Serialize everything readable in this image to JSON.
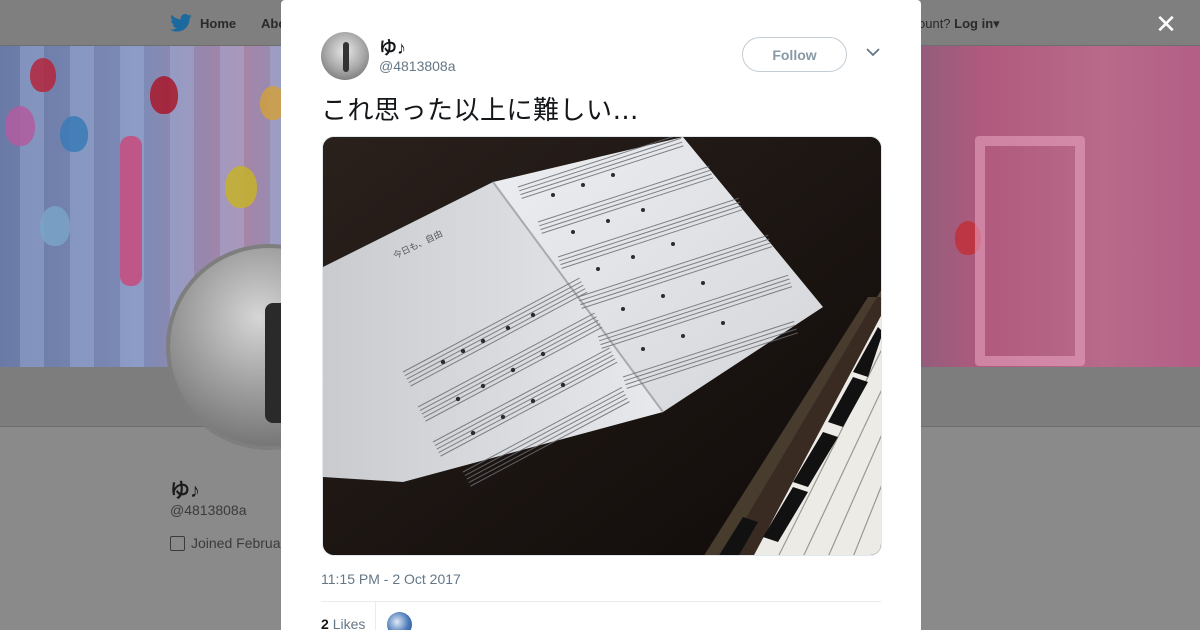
{
  "nav": {
    "home_label": "Home",
    "about_label": "Abo",
    "account_prompt": "ccount?",
    "login_label": "Log in"
  },
  "profile": {
    "name": "ゆ♪",
    "handle": "@4813808a",
    "joined": "Joined Februa"
  },
  "tweet": {
    "author_name": "ゆ♪",
    "author_handle": "@4813808a",
    "follow_label": "Follow",
    "text": "これ思った以上に難しい…",
    "photo_caption": "今日も、自由",
    "timestamp": "11:15 PM - 2 Oct 2017",
    "likes_count": "2",
    "likes_label": "Likes"
  },
  "icons": {
    "brand": "twitter-bird-icon",
    "close": "close-icon",
    "more": "chevron-down-icon",
    "calendar": "calendar-icon"
  },
  "colors": {
    "twitter_blue": "#1da1f2",
    "text_primary": "#14171a",
    "text_secondary": "#657786"
  }
}
